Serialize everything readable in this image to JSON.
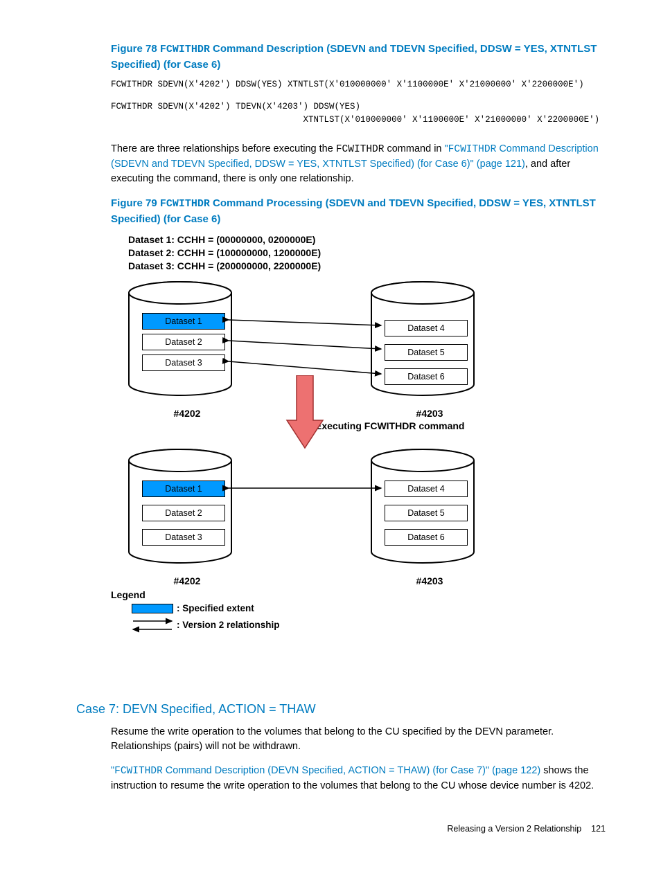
{
  "fig78": {
    "title_prefix": "Figure 78 ",
    "title_cmd": "FCWITHDR",
    "title_rest": " Command Description (SDEVN and TDEVN Specified, DDSW = YES, XTNTLST Specified) (for Case 6)",
    "code1": "FCWITHDR SDEVN(X'4202') DDSW(YES) XTNTLST(X'010000000' X'1100000E' X'21000000' X'2200000E')",
    "code2": "FCWITHDR SDEVN(X'4202') TDEVN(X'4203') DDSW(YES)\n                                     XTNTLST(X'010000000' X'1100000E' X'21000000' X'2200000E')"
  },
  "para1": {
    "t1": "There are three relationships before executing the ",
    "cmd": "FCWITHDR",
    "t2": " command in ",
    "link_q1": "\"",
    "link_cmd": "FCWITHDR",
    "link_text": " Command Description (SDEVN and TDEVN Specified, DDSW = YES, XTNTLST Specified) (for Case 6)\" (page 121)",
    "t3": ", and after executing the command, there is only one relationship."
  },
  "fig79": {
    "title_prefix": "Figure 79 ",
    "title_cmd": "FCWITHDR",
    "title_rest": " Command Processing (SDEVN and TDEVN Specified, DDSW = YES, XTNTLST Specified) (for Case 6)"
  },
  "diagram": {
    "header": {
      "l1": "Dataset 1:   CCHH = (00000000, 0200000E)",
      "l2": "Dataset 2:   CCHH = (100000000, 1200000E)",
      "l3": "Dataset 3:   CCHH = (200000000, 2200000E)"
    },
    "ds1": "Dataset 1",
    "ds2": "Dataset 2",
    "ds3": "Dataset 3",
    "ds4": "Dataset 4",
    "ds5": "Dataset 5",
    "ds6": "Dataset 6",
    "label_4202": "#4202",
    "label_4203": "#4203",
    "exec": "Executing FCWITHDR command",
    "legend": "Legend",
    "legend_spec": ": Specified extent",
    "legend_v2": ": Version 2 relationship"
  },
  "case7": {
    "heading": "Case 7: DEVN Specified, ACTION = THAW",
    "p1": "Resume the write operation to the volumes that belong to the CU specified by the DEVN parameter. Relationships (pairs) will not be withdrawn.",
    "link_q1": "\"",
    "link_cmd": "FCWITHDR",
    "link_text": " Command Description (DEVN Specified, ACTION = THAW) (for Case 7)\" (page 122)",
    "p2": " shows the instruction to resume the write operation to the volumes that belong to the CU whose device number is 4202."
  },
  "footer": {
    "text": "Releasing a Version 2 Relationship",
    "page": "121"
  }
}
